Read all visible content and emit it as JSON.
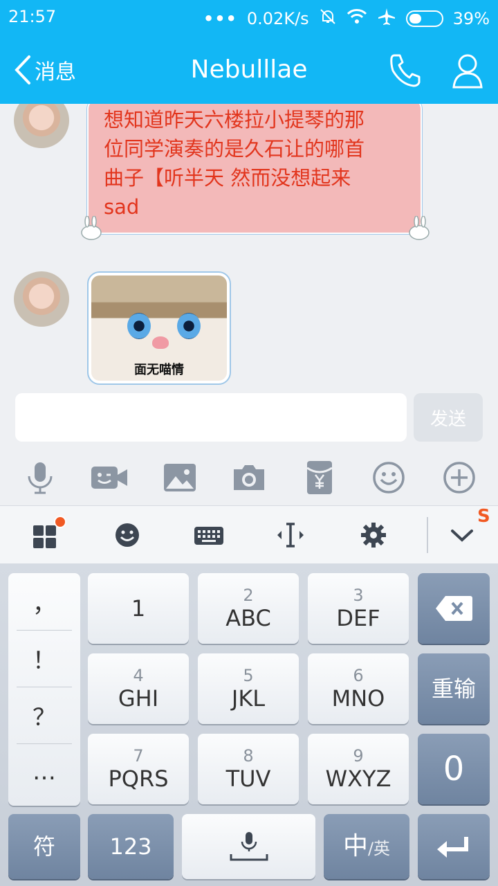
{
  "status_bar": {
    "time": "21:57",
    "network_speed": "0.02K/s",
    "battery_percent": "39%",
    "battery_level": 0.39,
    "icons": [
      "more-dots-icon",
      "mute-bell-icon",
      "wifi-icon",
      "airplane-icon",
      "battery-icon"
    ]
  },
  "header": {
    "back_label": "消息",
    "title": "Nebulllae",
    "icons": [
      "phone-icon",
      "contact-icon"
    ]
  },
  "messages": [
    {
      "type": "text",
      "lines": [
        "想知道昨天六楼拉小提琴的那",
        "位同学演奏的是久石让的哪首",
        "曲子【听半天 然而没想起来",
        "sad"
      ]
    },
    {
      "type": "sticker",
      "caption": "面无喵情"
    }
  ],
  "input": {
    "value": "",
    "placeholder": "",
    "send_label": "发送"
  },
  "tools": [
    "microphone-icon",
    "video-call-icon",
    "image-icon",
    "camera-icon",
    "red-packet-icon",
    "emoji-icon",
    "plus-icon"
  ],
  "keyboard": {
    "toolbar": [
      "apps-icon",
      "emoji-icon",
      "keyboard-icon",
      "cursor-icon",
      "settings-icon",
      "collapse-icon"
    ],
    "sogou_logo": "S",
    "punctuation": [
      "，",
      "！",
      "？",
      "…"
    ],
    "keys": [
      {
        "num": "",
        "label": "1"
      },
      {
        "num": "2",
        "label": "ABC"
      },
      {
        "num": "3",
        "label": "DEF"
      },
      {
        "num": "4",
        "label": "GHI"
      },
      {
        "num": "5",
        "label": "JKL"
      },
      {
        "num": "6",
        "label": "MNO"
      },
      {
        "num": "7",
        "label": "PQRS"
      },
      {
        "num": "8",
        "label": "TUV"
      },
      {
        "num": "9",
        "label": "WXYZ"
      }
    ],
    "delete_icon": "backspace-icon",
    "retype_label": "重输",
    "zero_label": "0",
    "symbol_label": "符",
    "numeric_label": "123",
    "voice_icon": "microphone-icon",
    "lang_main": "中",
    "lang_sub": "/英",
    "enter_icon": "enter-icon"
  },
  "colors": {
    "header_blue": "#12b7f5",
    "bubble_pink": "#f3b9b9",
    "bubble_text": "#e2351d",
    "accent_orange": "#f15a24"
  }
}
